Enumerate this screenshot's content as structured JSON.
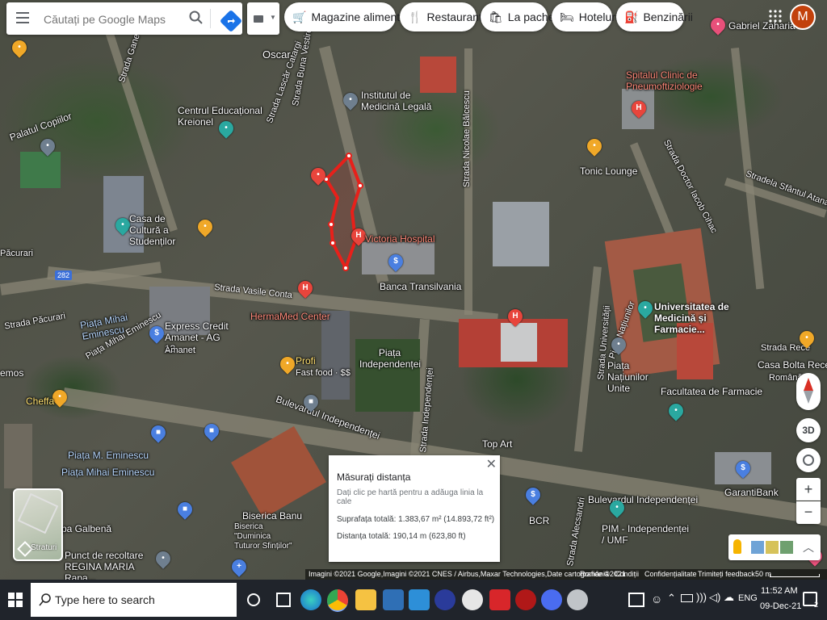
{
  "search": {
    "placeholder": "Căutați pe Google Maps"
  },
  "chips": [
    {
      "icon": "cart-icon",
      "label": "Magazine alimentare"
    },
    {
      "icon": "fork-knife-icon",
      "label": "Restaurante"
    },
    {
      "icon": "takeout-icon",
      "label": "La pachet"
    },
    {
      "icon": "bed-icon",
      "label": "Hoteluri"
    },
    {
      "icon": "fuel-icon",
      "label": "Benzinării"
    }
  ],
  "account": {
    "initial": "M"
  },
  "places": {
    "institut": "Institutul de Medicină Legală",
    "centru": "Centrul Educațional Kreionel",
    "palatul": "Palatul Copiilor",
    "casa_cultura": "Casa de Cultură a Studenților",
    "victoria": "Victoria Hospital",
    "banca": "Banca Transilvania",
    "hermamed": "HermaMed Center",
    "express": "Express Credit Amanet - AG 13",
    "express_sub": "Amanet",
    "profi": "Profi",
    "profi_sub": "Fast food · $$",
    "piata_indep": "Piața Independenței",
    "piata_eminescu1": "Piața Mihai Eminescu",
    "piata_eminescu2": "Piața M. Eminescu",
    "piata_eminescu3": "Piața Mihai Eminescu",
    "cheffa": "Cheffa",
    "tonic": "Tonic Lounge",
    "spital": "Spitalul Clinic de Pneumoftiziologie",
    "gabriel": "Gabriel Zaharia",
    "umf": "Universitatea de Medicină și Farmacie...",
    "facultatea": "Facultatea de Farmacie",
    "piata_natiunilor": "Piața Națiunilor Unite",
    "casa_bolta": "Casa Bolta Rece",
    "casa_bolta_sub": "Română",
    "garanti": "GarantiBank",
    "bcr": "BCR",
    "pim": "PIM - Independenței / UMF",
    "top_art": "Top Art",
    "biserica": "Biserica Banu",
    "biserica_sub": "Biserica \"Duminica Tuturor Sfinților\"",
    "punct": "Punct de recoltare REGINA MARIA Rapa...",
    "pa_galbena": "pa Galbenă",
    "emos": "emos",
    "oscar": "Oscar"
  },
  "streets": {
    "buna_vestire": "Strada Buna Vestire",
    "nicolae_balcescu": "Strada Nicolae Bălcescu",
    "vasile_conta": "Strada Vasile Conta",
    "pacurari1": "Păcurari",
    "pacurari2": "Strada Păcurari",
    "mihai_eminescu": "Piața Mihai Eminescu",
    "bulevardul1": "Bulevardul Independenței",
    "bulevardul2": "Bulevardul Independenței",
    "strada_indep": "Strada Independenței",
    "strada_univ": "Strada Universității",
    "piata_natiunilor_st": "Piața Națiunilor",
    "lascar": "Strada Lascăr Catargi",
    "sf_atanasie": "Stradela Sfântul Atanasie",
    "doctor": "Strada Doctor Iacob Cihac",
    "rece": "Strada Rece",
    "alecsandri": "Strada Alecsandri",
    "road_number": "282",
    "gane": "Strada Gane"
  },
  "measure": {
    "title": "Măsurați distanța",
    "hint": "Dați clic pe hartă pentru a adăuga linia la cale",
    "area": "Suprafața totală: 1.383,67 m² (14.893,72 ft²)",
    "distance": "Distanța totală: 190,14 m (623,80 ft)"
  },
  "layers": {
    "label": "Straturi"
  },
  "controls": {
    "threed": "3D",
    "zoom_in": "+",
    "zoom_out": "−"
  },
  "attribution": {
    "imagery": "Imagini ©2021 Google,Imagini ©2021 CNES / Airbus,Maxar Technologies,Date cartografice ©2021",
    "country": "România",
    "terms": "Condiții",
    "privacy": "Confidențialitate",
    "feedback": "Trimiteți feedback",
    "scale": "50 m"
  },
  "taskbar": {
    "search_placeholder": "Type here to search",
    "lang": "ENG",
    "time": "11:52 AM",
    "date": "09-Dec-21",
    "notif_count": "2"
  },
  "colors": {
    "polygon": "#e8201a",
    "accent_blue": "#1a73e8",
    "taskbar": "#20242b"
  }
}
